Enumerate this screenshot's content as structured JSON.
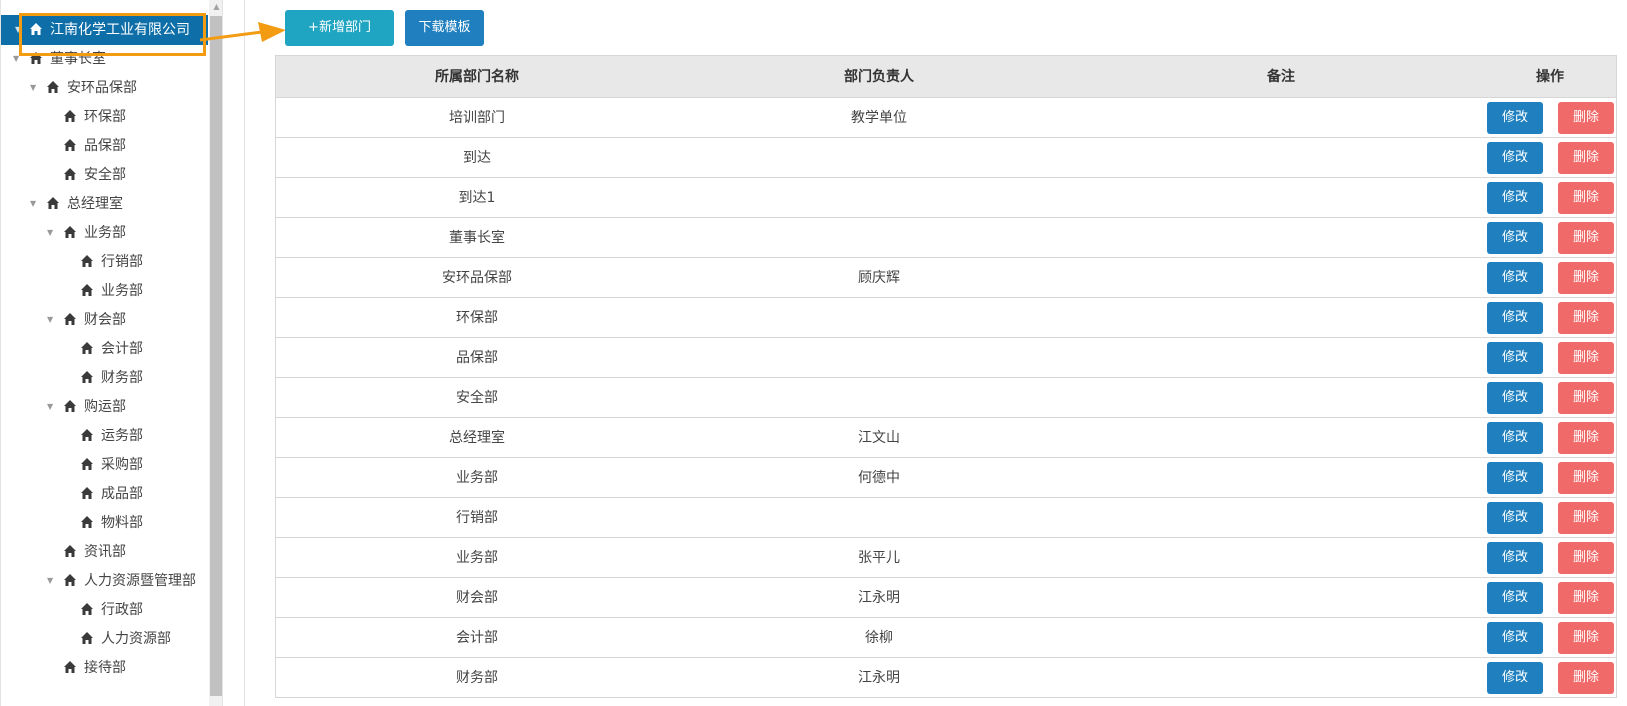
{
  "sidebar": {
    "root": "江南化学工业有限公司",
    "items": [
      {
        "label": "董事长室",
        "expanded": true
      },
      {
        "label": "安环品保部",
        "expanded": true
      },
      {
        "label": "环保部"
      },
      {
        "label": "品保部"
      },
      {
        "label": "安全部"
      },
      {
        "label": "总经理室",
        "expanded": true
      },
      {
        "label": "业务部",
        "expanded": true
      },
      {
        "label": "行销部"
      },
      {
        "label": "业务部"
      },
      {
        "label": "财会部",
        "expanded": true
      },
      {
        "label": "会计部"
      },
      {
        "label": "财务部"
      },
      {
        "label": "购运部",
        "expanded": true
      },
      {
        "label": "运务部"
      },
      {
        "label": "采购部"
      },
      {
        "label": "成品部"
      },
      {
        "label": "物料部"
      },
      {
        "label": "资讯部"
      },
      {
        "label": "人力资源暨管理部",
        "expanded": true
      },
      {
        "label": "行政部"
      },
      {
        "label": "人力资源部"
      },
      {
        "label": "接待部"
      }
    ]
  },
  "toolbar": {
    "add_label": "+新增部门",
    "template_label": "下载模板"
  },
  "table": {
    "columns": [
      "所属部门名称",
      "部门负责人",
      "备注",
      "操作"
    ],
    "edit_label": "修改",
    "delete_label": "删除",
    "rows": [
      {
        "name": "培训部门",
        "leader": "教学单位",
        "note": ""
      },
      {
        "name": "到达",
        "leader": "",
        "note": ""
      },
      {
        "name": "到达1",
        "leader": "",
        "note": ""
      },
      {
        "name": "董事长室",
        "leader": "",
        "note": ""
      },
      {
        "name": "安环品保部",
        "leader": "顾庆辉",
        "note": ""
      },
      {
        "name": "环保部",
        "leader": "",
        "note": ""
      },
      {
        "name": "品保部",
        "leader": "",
        "note": ""
      },
      {
        "name": "安全部",
        "leader": "",
        "note": ""
      },
      {
        "name": "总经理室",
        "leader": "江文山",
        "note": ""
      },
      {
        "name": "业务部",
        "leader": "何德中",
        "note": ""
      },
      {
        "name": "行销部",
        "leader": "",
        "note": ""
      },
      {
        "name": "业务部",
        "leader": "张平儿",
        "note": ""
      },
      {
        "name": "财会部",
        "leader": "江永明",
        "note": ""
      },
      {
        "name": "会计部",
        "leader": "徐柳",
        "note": ""
      },
      {
        "name": "财务部",
        "leader": "江永明",
        "note": ""
      }
    ]
  },
  "colors": {
    "active_node": "#0e6fa8",
    "add_button": "#1fa5c2",
    "primary_button": "#1f7fbf",
    "delete_button": "#f06a6a",
    "highlight": "#f39c12"
  },
  "icons": {
    "tree_node": "home-icon",
    "expanded": "caret-down-icon",
    "scroll_up": "arrow-up-icon"
  }
}
